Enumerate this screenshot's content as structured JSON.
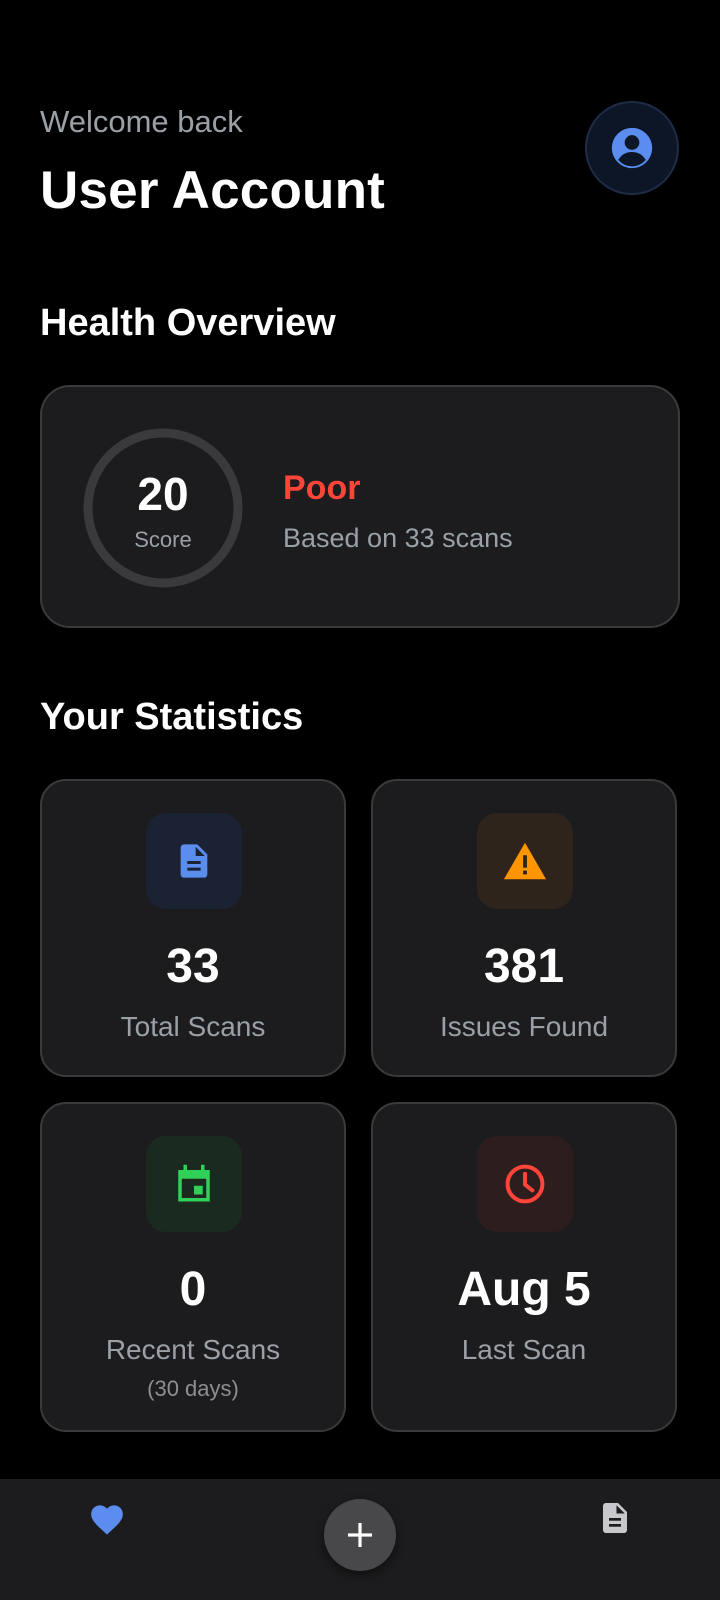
{
  "header": {
    "welcome": "Welcome back",
    "title": "User Account",
    "avatar_icon": "account-circle-icon"
  },
  "health": {
    "section_title": "Health Overview",
    "score": "20",
    "score_label": "Score",
    "status": "Poor",
    "status_color": "#ff453a",
    "subtitle": "Based on 33 scans"
  },
  "statistics": {
    "section_title": "Your Statistics",
    "cards": [
      {
        "icon": "document-icon",
        "value": "33",
        "label": "Total Scans",
        "accent": "#5b8def"
      },
      {
        "icon": "warning-icon",
        "value": "381",
        "label": "Issues Found",
        "accent": "#ff9500"
      },
      {
        "icon": "calendar-icon",
        "value": "0",
        "label": "Recent Scans",
        "sublabel": "(30 days)",
        "accent": "#30d158"
      },
      {
        "icon": "clock-icon",
        "value": "Aug 5",
        "label": "Last Scan",
        "accent": "#ff453a"
      }
    ]
  },
  "nav": {
    "items": [
      {
        "icon": "heart-icon",
        "active": true
      },
      {
        "icon": "plus-icon"
      },
      {
        "icon": "document-icon"
      }
    ],
    "active_color": "#5b8def"
  }
}
